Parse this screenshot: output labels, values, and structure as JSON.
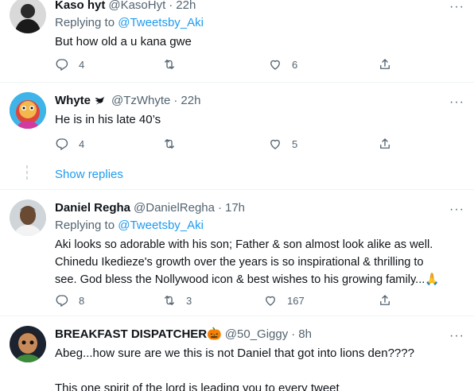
{
  "tweets": [
    {
      "name": "Kaso hyt",
      "handle": "@KasoHyt",
      "dot": "·",
      "time": "22h",
      "replying_prefix": "Replying to",
      "replying_to": "@Tweetsby_Aki",
      "text": "But how old a u kana gwe",
      "replies": "4",
      "retweets": "",
      "likes": "6"
    },
    {
      "name": "Whyte",
      "handle": "@TzWhyte",
      "dot": "·",
      "time": "22h",
      "text": "He is in his late 40’s",
      "replies": "4",
      "retweets": "",
      "likes": "5"
    },
    {
      "name": "Daniel Regha",
      "handle": "@DanielRegha",
      "dot": "·",
      "time": "17h",
      "replying_prefix": "Replying to",
      "replying_to": "@Tweetsby_Aki",
      "text_line1": "Aki looks so adorable with his son; Father & son almost look alike as well.",
      "text_line2": "Chinedu Ikedieze's growth over the years is so inspirational & thrilling to",
      "text_line3": "see. God bless the Nollywood icon & best wishes to his growing family...🙏",
      "replies": "8",
      "retweets": "3",
      "likes": "167"
    },
    {
      "name": "BREAKFAST DISPATCHER🎃",
      "handle": "@50_Giggy",
      "dot": "·",
      "time": "8h",
      "text_line1": "Abeg...how sure are we this is not Daniel that got into lions den????",
      "text_line2": "This one spirit of the lord is leading you to every tweet"
    }
  ],
  "show_replies": "Show replies",
  "more_glyph": "···",
  "colors": {
    "accent": "#1d9bf0",
    "secondary_text": "#536471",
    "divider": "#eff3f4"
  },
  "icons": [
    "reply-icon",
    "retweet-icon",
    "like-icon",
    "share-icon",
    "more-icon",
    "verified-icon"
  ]
}
